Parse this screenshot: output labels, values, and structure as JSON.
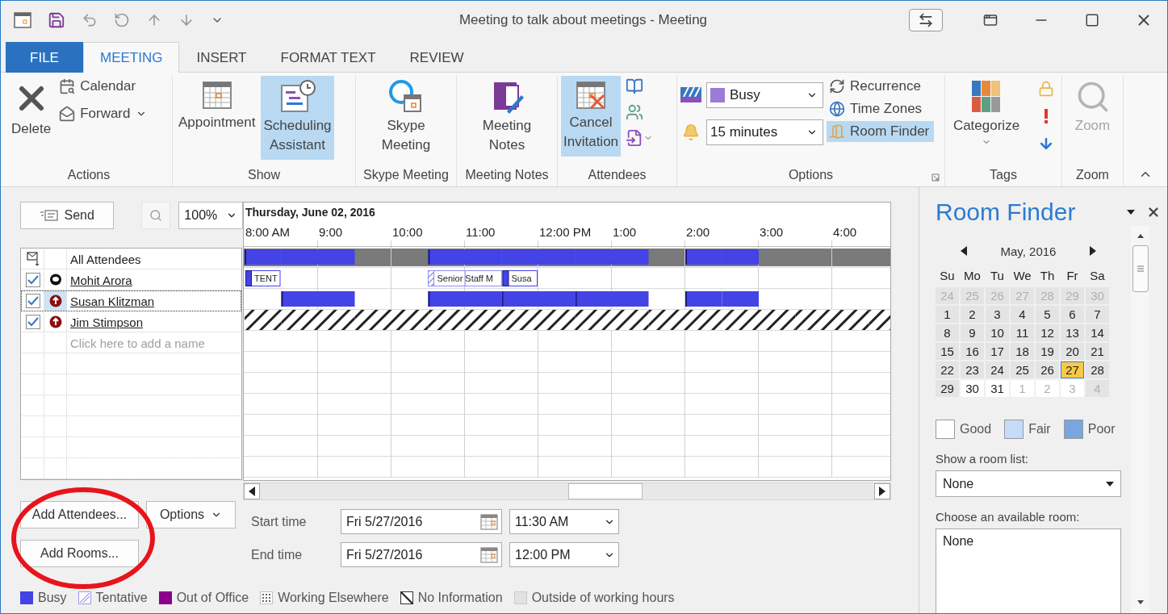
{
  "window": {
    "title": "Meeting to talk about meetings - Meeting"
  },
  "tabs": [
    {
      "label": "FILE",
      "kind": "file",
      "selected": false
    },
    {
      "label": "MEETING",
      "kind": "tab",
      "selected": true
    },
    {
      "label": "INSERT",
      "kind": "tab",
      "selected": false
    },
    {
      "label": "FORMAT TEXT",
      "kind": "tab",
      "selected": false
    },
    {
      "label": "REVIEW",
      "kind": "tab",
      "selected": false
    }
  ],
  "ribbon": {
    "actions": {
      "label": "Actions",
      "delete": {
        "label": "Delete"
      },
      "calendar": {
        "label": "Calendar"
      },
      "forward": {
        "label": "Forward"
      }
    },
    "show": {
      "label": "Show",
      "appointment": {
        "label": "Appointment",
        "selected": false
      },
      "scheduling_assistant": {
        "label": "Scheduling Assistant",
        "selected": true
      }
    },
    "skype_meeting": {
      "label": "Skype Meeting",
      "button": {
        "label": "Skype Meeting"
      }
    },
    "meeting_notes": {
      "label": "Meeting Notes",
      "button": {
        "label": "Meeting Notes"
      }
    },
    "attendees": {
      "label": "Attendees",
      "cancel_invitation": {
        "label": "Cancel Invitation",
        "selected": true
      }
    },
    "options": {
      "label": "Options",
      "show_as": {
        "value": "Busy"
      },
      "reminder": {
        "value": "15 minutes"
      },
      "recurrence": {
        "label": "Recurrence",
        "selected": false
      },
      "time_zones": {
        "label": "Time Zones",
        "selected": false
      },
      "room_finder": {
        "label": "Room Finder",
        "selected": true
      }
    },
    "tags": {
      "label": "Tags",
      "categorize": {
        "label": "Categorize"
      }
    },
    "zoom": {
      "label": "Zoom",
      "button": {
        "label": "Zoom",
        "disabled": true
      }
    }
  },
  "scheduling": {
    "send": {
      "label": "Send"
    },
    "zoom_level": {
      "value": "100%"
    },
    "attendees": {
      "header": {
        "label": "All Attendees",
        "slots": [
          {
            "kind": "busy",
            "start": true
          },
          {
            "kind": "busy",
            "start": false
          },
          {
            "kind": "busy",
            "start": false
          },
          {
            "kind": "free"
          },
          {
            "kind": "free"
          },
          {
            "kind": "busy",
            "start": true
          },
          {
            "kind": "busy",
            "start": false
          },
          {
            "kind": "busy",
            "start": false
          },
          {
            "kind": "busy",
            "start": false
          },
          {
            "kind": "busy",
            "start": false
          },
          {
            "kind": "busy",
            "start": false
          },
          {
            "kind": "free"
          },
          {
            "kind": "busy",
            "start": true
          },
          {
            "kind": "busy",
            "start": false
          },
          {
            "kind": "free"
          },
          {
            "kind": "free"
          },
          {
            "kind": "free"
          },
          {
            "kind": "free"
          }
        ]
      },
      "placeholder": "Click here to add a name",
      "rows": [
        {
          "name": "Mohit Arora",
          "kind": "organizer",
          "checked": true,
          "selected": false,
          "slots": [
            {
              "kind": "busy",
              "start": true,
              "label": "TENT"
            },
            {
              "kind": "free"
            },
            {
              "kind": "free"
            },
            {
              "kind": "free"
            },
            {
              "kind": "free"
            },
            {
              "kind": "tentative",
              "label": "Senior Staff M"
            },
            {
              "kind": "tentative"
            },
            {
              "kind": "busy",
              "start": true,
              "label": "Susa"
            },
            {
              "kind": "free"
            },
            {
              "kind": "free"
            },
            {
              "kind": "free"
            },
            {
              "kind": "free"
            },
            {
              "kind": "free"
            },
            {
              "kind": "free"
            },
            {
              "kind": "free"
            },
            {
              "kind": "free"
            },
            {
              "kind": "free"
            },
            {
              "kind": "free"
            }
          ]
        },
        {
          "name": "Susan Klitzman",
          "kind": "required",
          "checked": true,
          "selected": true,
          "slots": [
            {
              "kind": "free"
            },
            {
              "kind": "busy",
              "start": true
            },
            {
              "kind": "busy",
              "start": false
            },
            {
              "kind": "free"
            },
            {
              "kind": "free"
            },
            {
              "kind": "busy",
              "start": true
            },
            {
              "kind": "busy",
              "start": false
            },
            {
              "kind": "busy",
              "start": true
            },
            {
              "kind": "busy",
              "start": false
            },
            {
              "kind": "busy",
              "start": true
            },
            {
              "kind": "busy",
              "start": false
            },
            {
              "kind": "free"
            },
            {
              "kind": "busy",
              "start": true
            },
            {
              "kind": "busy",
              "start": false
            },
            {
              "kind": "free"
            },
            {
              "kind": "free"
            },
            {
              "kind": "free"
            },
            {
              "kind": "free"
            }
          ]
        },
        {
          "name": "Jim Stimpson",
          "kind": "required",
          "checked": true,
          "selected": false,
          "slots": [
            {
              "kind": "noinfo"
            },
            {
              "kind": "noinfo"
            },
            {
              "kind": "noinfo"
            },
            {
              "kind": "noinfo"
            },
            {
              "kind": "noinfo"
            },
            {
              "kind": "noinfo"
            },
            {
              "kind": "noinfo"
            },
            {
              "kind": "noinfo"
            },
            {
              "kind": "noinfo"
            },
            {
              "kind": "noinfo"
            },
            {
              "kind": "noinfo"
            },
            {
              "kind": "noinfo"
            },
            {
              "kind": "noinfo"
            },
            {
              "kind": "noinfo"
            },
            {
              "kind": "noinfo"
            },
            {
              "kind": "noinfo"
            },
            {
              "kind": "noinfo"
            },
            {
              "kind": "noinfo"
            }
          ]
        }
      ]
    },
    "timeline": {
      "date": "Thursday, June 02, 2016",
      "hours": [
        "8:00 AM",
        "9:00",
        "10:00",
        "11:00",
        "12:00 PM",
        "1:00",
        "2:00",
        "3:00",
        "4:00"
      ]
    },
    "buttons": {
      "add_attendees": "Add Attendees...",
      "options": "Options",
      "add_rooms": "Add Rooms..."
    },
    "start": {
      "label": "Start time",
      "date": "Fri 5/27/2016",
      "time": "11:30 AM"
    },
    "end": {
      "label": "End time",
      "date": "Fri 5/27/2016",
      "time": "12:00 PM"
    }
  },
  "legend": [
    {
      "label": "Busy",
      "kind": "busy"
    },
    {
      "label": "Tentative",
      "kind": "tentative"
    },
    {
      "label": "Out of Office",
      "kind": "oof"
    },
    {
      "label": "Working Elsewhere",
      "kind": "elsewhere"
    },
    {
      "label": "No Information",
      "kind": "noinfo"
    },
    {
      "label": "Outside of working hours",
      "kind": "outside"
    }
  ],
  "room_finder": {
    "title": "Room Finder",
    "month": "May, 2016",
    "weekdays": [
      "Su",
      "Mo",
      "Tu",
      "We",
      "Th",
      "Fr",
      "Sa"
    ],
    "days": [
      {
        "label": "24",
        "kind": "past",
        "muted": true,
        "selected": false
      },
      {
        "label": "25",
        "kind": "past",
        "muted": true,
        "selected": false
      },
      {
        "label": "26",
        "kind": "past",
        "muted": true,
        "selected": false
      },
      {
        "label": "27",
        "kind": "past",
        "muted": true,
        "selected": false
      },
      {
        "label": "28",
        "kind": "past",
        "muted": true,
        "selected": false
      },
      {
        "label": "29",
        "kind": "past",
        "muted": true,
        "selected": false
      },
      {
        "label": "30",
        "kind": "past",
        "muted": true,
        "selected": false
      },
      {
        "label": "1",
        "kind": "past",
        "muted": false,
        "selected": false
      },
      {
        "label": "2",
        "kind": "past",
        "muted": false,
        "selected": false
      },
      {
        "label": "3",
        "kind": "past",
        "muted": false,
        "selected": false
      },
      {
        "label": "4",
        "kind": "past",
        "muted": false,
        "selected": false
      },
      {
        "label": "5",
        "kind": "past",
        "muted": false,
        "selected": false
      },
      {
        "label": "6",
        "kind": "past",
        "muted": false,
        "selected": false
      },
      {
        "label": "7",
        "kind": "past",
        "muted": false,
        "selected": false
      },
      {
        "label": "8",
        "kind": "past",
        "muted": false,
        "selected": false
      },
      {
        "label": "9",
        "kind": "past",
        "muted": false,
        "selected": false
      },
      {
        "label": "10",
        "kind": "past",
        "muted": false,
        "selected": false
      },
      {
        "label": "11",
        "kind": "past",
        "muted": false,
        "selected": false
      },
      {
        "label": "12",
        "kind": "past",
        "muted": false,
        "selected": false
      },
      {
        "label": "13",
        "kind": "past",
        "muted": false,
        "selected": false
      },
      {
        "label": "14",
        "kind": "past",
        "muted": false,
        "selected": false
      },
      {
        "label": "15",
        "kind": "past",
        "muted": false,
        "selected": false
      },
      {
        "label": "16",
        "kind": "past",
        "muted": false,
        "selected": false
      },
      {
        "label": "17",
        "kind": "past",
        "muted": false,
        "selected": false
      },
      {
        "label": "18",
        "kind": "past",
        "muted": false,
        "selected": false
      },
      {
        "label": "19",
        "kind": "past",
        "muted": false,
        "selected": false
      },
      {
        "label": "20",
        "kind": "past",
        "muted": false,
        "selected": false
      },
      {
        "label": "21",
        "kind": "past",
        "muted": false,
        "selected": false
      },
      {
        "label": "22",
        "kind": "past",
        "muted": false,
        "selected": false
      },
      {
        "label": "23",
        "kind": "past",
        "muted": false,
        "selected": false
      },
      {
        "label": "24",
        "kind": "past",
        "muted": false,
        "selected": false
      },
      {
        "label": "25",
        "kind": "past",
        "muted": false,
        "selected": false
      },
      {
        "label": "26",
        "kind": "past",
        "muted": false,
        "selected": false
      },
      {
        "label": "27",
        "kind": "past",
        "muted": false,
        "selected": true
      },
      {
        "label": "28",
        "kind": "past",
        "muted": false,
        "selected": false
      },
      {
        "label": "29",
        "kind": "past",
        "muted": false,
        "selected": false
      },
      {
        "label": "30",
        "kind": "open",
        "muted": false,
        "selected": false
      },
      {
        "label": "31",
        "kind": "open",
        "muted": false,
        "selected": false
      },
      {
        "label": "1",
        "kind": "open",
        "muted": true,
        "selected": false
      },
      {
        "label": "2",
        "kind": "open",
        "muted": true,
        "selected": false
      },
      {
        "label": "3",
        "kind": "open",
        "muted": true,
        "selected": false
      },
      {
        "label": "4",
        "kind": "past",
        "muted": true,
        "selected": false
      }
    ],
    "legend": [
      {
        "label": "Good",
        "color": "#ffffff"
      },
      {
        "label": "Fair",
        "color": "#c5dcf8"
      },
      {
        "label": "Poor",
        "color": "#7aa6e0"
      }
    ],
    "room_list": {
      "label": "Show a room list:",
      "value": "None"
    },
    "rooms": {
      "label": "Choose an available room:",
      "items": [
        "None"
      ]
    }
  }
}
